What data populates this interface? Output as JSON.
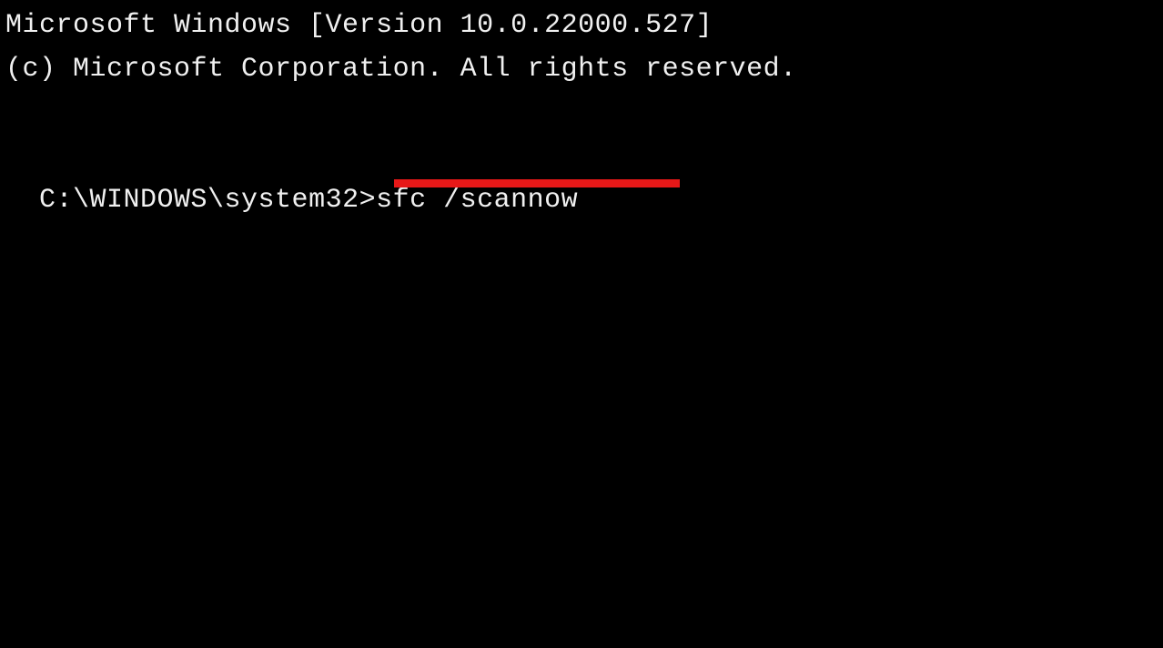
{
  "terminal": {
    "version_line": "Microsoft Windows [Version 10.0.22000.527]",
    "copyright_line": "(c) Microsoft Corporation. All rights reserved.",
    "prompt": "C:\\WINDOWS\\system32>",
    "command": "sfc /scannow"
  },
  "annotation": {
    "underline_color": "#e71818"
  }
}
